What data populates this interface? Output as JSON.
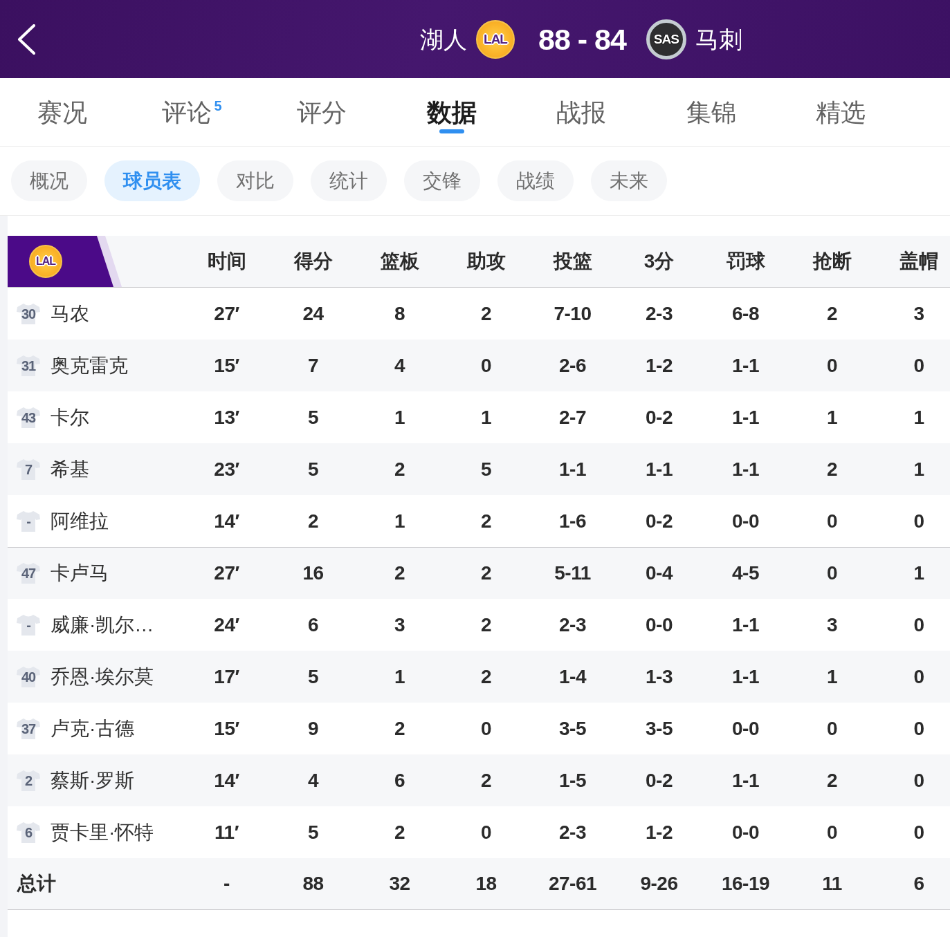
{
  "header": {
    "home_team": {
      "name": "湖人",
      "logo_text": "LAL"
    },
    "score": "88 - 84",
    "away_team": {
      "name": "马刺",
      "logo_text": "SAS"
    }
  },
  "tabs": [
    {
      "label": "赛况",
      "selected": false
    },
    {
      "label": "评论",
      "badge": "5",
      "selected": false
    },
    {
      "label": "评分",
      "selected": false
    },
    {
      "label": "数据",
      "selected": true
    },
    {
      "label": "战报",
      "selected": false
    },
    {
      "label": "集锦",
      "selected": false
    },
    {
      "label": "精选",
      "selected": false
    }
  ],
  "sub_tabs": [
    {
      "label": "概况",
      "selected": false
    },
    {
      "label": "球员表",
      "selected": true
    },
    {
      "label": "对比",
      "selected": false
    },
    {
      "label": "统计",
      "selected": false
    },
    {
      "label": "交锋",
      "selected": false
    },
    {
      "label": "战绩",
      "selected": false
    },
    {
      "label": "未来",
      "selected": false
    }
  ],
  "player_table": {
    "team_logo_text": "LAL",
    "columns": [
      "时间",
      "得分",
      "篮板",
      "助攻",
      "投篮",
      "3分",
      "罚球",
      "抢断",
      "盖帽"
    ],
    "starters": [
      {
        "number": "30",
        "name": "马农",
        "stats": [
          "27′",
          "24",
          "8",
          "2",
          "7-10",
          "2-3",
          "6-8",
          "2",
          "3"
        ]
      },
      {
        "number": "31",
        "name": "奥克雷克",
        "stats": [
          "15′",
          "7",
          "4",
          "0",
          "2-6",
          "1-2",
          "1-1",
          "0",
          "0"
        ]
      },
      {
        "number": "43",
        "name": "卡尔",
        "stats": [
          "13′",
          "5",
          "1",
          "1",
          "2-7",
          "0-2",
          "1-1",
          "1",
          "1"
        ]
      },
      {
        "number": "7",
        "name": "希基",
        "stats": [
          "23′",
          "5",
          "2",
          "5",
          "1-1",
          "1-1",
          "1-1",
          "2",
          "1"
        ]
      },
      {
        "number": "-",
        "name": "阿维拉",
        "stats": [
          "14′",
          "2",
          "1",
          "2",
          "1-6",
          "0-2",
          "0-0",
          "0",
          "0"
        ]
      }
    ],
    "bench": [
      {
        "number": "47",
        "name": "卡卢马",
        "stats": [
          "27′",
          "16",
          "2",
          "2",
          "5-11",
          "0-4",
          "4-5",
          "0",
          "1"
        ]
      },
      {
        "number": "-",
        "name": "威廉·凯尔…",
        "stats": [
          "24′",
          "6",
          "3",
          "2",
          "2-3",
          "0-0",
          "1-1",
          "3",
          "0"
        ]
      },
      {
        "number": "40",
        "name": "乔恩·埃尔莫",
        "stats": [
          "17′",
          "5",
          "1",
          "2",
          "1-4",
          "1-3",
          "1-1",
          "1",
          "0"
        ]
      },
      {
        "number": "37",
        "name": "卢克·古德",
        "stats": [
          "15′",
          "9",
          "2",
          "0",
          "3-5",
          "3-5",
          "0-0",
          "0",
          "0"
        ]
      },
      {
        "number": "2",
        "name": "蔡斯·罗斯",
        "stats": [
          "14′",
          "4",
          "6",
          "2",
          "1-5",
          "0-2",
          "1-1",
          "2",
          "0"
        ]
      },
      {
        "number": "6",
        "name": "贾卡里·怀特",
        "stats": [
          "11′",
          "5",
          "2",
          "0",
          "2-3",
          "1-2",
          "0-0",
          "0",
          "0"
        ]
      }
    ],
    "total": {
      "label": "总计",
      "stats": [
        "-",
        "88",
        "32",
        "18",
        "27-61",
        "9-26",
        "16-19",
        "11",
        "6"
      ]
    }
  }
}
